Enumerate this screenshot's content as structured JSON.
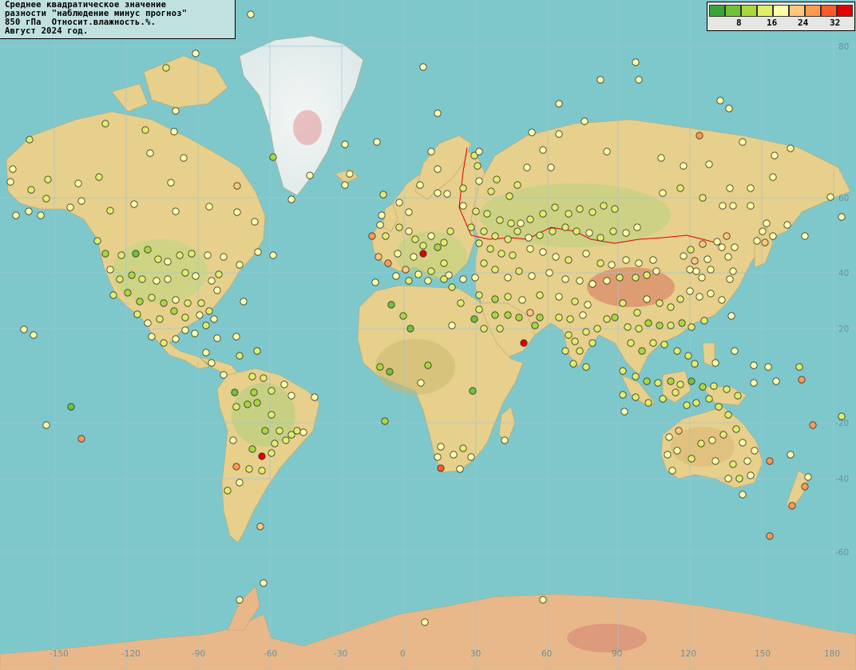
{
  "title": {
    "line1": "Среднее квадратическое значение",
    "line2": "разности \"наблюдение минус прогноз\"",
    "line3": "850 гПа  Относит.влажность.%.",
    "line4": "Август 2024 год."
  },
  "legend": {
    "colors": [
      "#3aa53a",
      "#6fc23a",
      "#a8d83c",
      "#e0ee6a",
      "#ffffa8",
      "#ffc87a",
      "#ff9a50",
      "#ff5a2a",
      "#e00000"
    ],
    "ticks": [
      "8",
      "16",
      "24",
      "32"
    ]
  },
  "axes": {
    "longitude_labels": [
      "-150",
      "-120",
      "-90",
      "-60",
      "-30",
      "0",
      "30",
      "60",
      "90",
      "120",
      "150",
      "180"
    ],
    "latitude_labels": [
      "80",
      "60",
      "40",
      "20",
      "-20",
      "-40",
      "-60"
    ]
  },
  "map_data": {
    "projection": "mercator",
    "variable": "Относит.влажность",
    "level_hpa": 850,
    "period": "Август 2024",
    "station_color_scale": [
      "#3aa53a",
      "#6fc23a",
      "#a8d83c",
      "#e0ee6a",
      "#ffffa8",
      "#ffc87a",
      "#ff9a50",
      "#ff5a2a",
      "#e00000"
    ]
  }
}
